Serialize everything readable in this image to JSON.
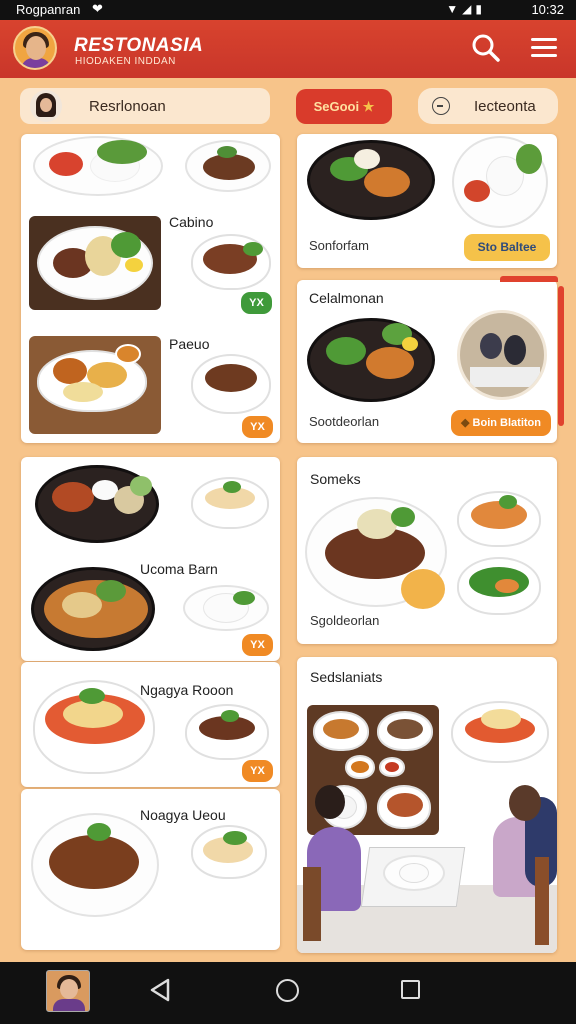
{
  "status_bar": {
    "carrier": "Rogpanran",
    "time": "10:32"
  },
  "header": {
    "brand": "RESTONASIA",
    "tagline": "HIODAKEN INDDAN"
  },
  "filters": {
    "profile_label": "Resrlonoan",
    "special_label": "SeGooi",
    "time_label": "Iecteonta"
  },
  "left_column": [
    {
      "title": "",
      "badge": ""
    },
    {
      "title": "Cabino",
      "badge": "YX"
    },
    {
      "title": "Paeuo",
      "badge": "YX"
    },
    {
      "title": "Ucoma Barn",
      "badge": "YX"
    },
    {
      "title": "Ngagya Rooon",
      "badge": "YX"
    },
    {
      "title": "Noagya Ueou",
      "badge": ""
    }
  ],
  "right_column": [
    {
      "title": "",
      "subtitle": "Sonforfam",
      "badge": "Sto Baltee"
    },
    {
      "title": "Celalmonan",
      "subtitle": "Sootdeorlan",
      "badge": "Boin Blatiton"
    },
    {
      "title": "Someks",
      "subtitle": "Sgoldeorlan",
      "badge": ""
    },
    {
      "title": "Sedslaniats",
      "subtitle": "",
      "badge": ""
    }
  ],
  "colors": {
    "accent": "#d8432e",
    "background": "#f7c48a",
    "badge_green": "#3f9a3a",
    "badge_orange": "#f08a24",
    "badge_yellow": "#f5c24a"
  },
  "icons": [
    "search-icon",
    "menu-icon",
    "clock-icon",
    "back-icon",
    "home-icon",
    "recent-apps-icon"
  ]
}
